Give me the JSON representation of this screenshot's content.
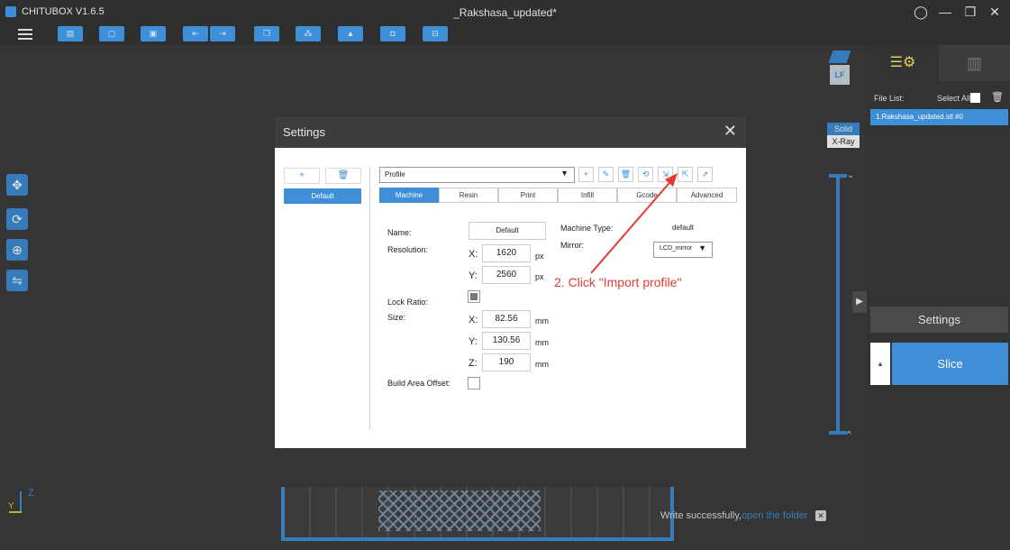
{
  "titlebar": {
    "app_name": "CHITUBOX V1.6.5",
    "document_title": "_Rakshasa_updated*",
    "user_icon": "user-icon",
    "min_glyph": "—",
    "max_glyph": "❐",
    "close_glyph": "✕"
  },
  "toolbar": {
    "menu_icon": "hamburger-icon",
    "buttons": [
      {
        "name": "open-file-button",
        "glyph": "▤"
      },
      {
        "name": "open-project-button",
        "glyph": "▢"
      },
      {
        "name": "save-button",
        "glyph": "▣"
      },
      {
        "name": "import-button",
        "glyph": "⇤"
      },
      {
        "name": "export-button",
        "glyph": "⇥"
      },
      {
        "name": "copy-button",
        "glyph": "❐"
      },
      {
        "name": "layout-button",
        "glyph": "⁂"
      },
      {
        "name": "support-button",
        "glyph": "▲"
      },
      {
        "name": "hollow-button",
        "glyph": "◘"
      },
      {
        "name": "cut-button",
        "glyph": "⊟"
      }
    ]
  },
  "viewport": {
    "side_tools": [
      {
        "name": "move-tool",
        "glyph": "✥"
      },
      {
        "name": "rotate-tool",
        "glyph": "⟳"
      },
      {
        "name": "scale-tool",
        "glyph": "⊕"
      },
      {
        "name": "mirror-tool",
        "glyph": "⇋"
      }
    ],
    "axis_z": "Z",
    "axis_y": "Y",
    "view_modes": {
      "solid": "Solid",
      "xray": "X-Ray"
    },
    "viewcube_label": "LF",
    "toast": {
      "message": "Write successfully,",
      "link": "open the folder",
      "close": "✕"
    },
    "layer_up": "⌄",
    "layer_down": "^",
    "collapse": "▶"
  },
  "right_panel": {
    "tab_edit_glyph": "☰⚙",
    "tab_support_glyph": "▥",
    "file_list_label": "File List:",
    "select_all_label": "Select All",
    "delete_glyph": "🗑",
    "files": [
      "1.Rakshasa_updated.stl #0"
    ],
    "settings_label": "Settings",
    "slice_label": "Slice",
    "slice_expand": "▲"
  },
  "dialog": {
    "title": "Settings",
    "close_glyph": "✕",
    "left": {
      "add_glyph": "+",
      "delete_glyph": "🗑",
      "profiles": [
        "Default"
      ]
    },
    "profile_select": "Profile",
    "profile_icons": [
      {
        "name": "new-profile-icon",
        "glyph": "+"
      },
      {
        "name": "edit-profile-icon",
        "glyph": "✎"
      },
      {
        "name": "delete-profile-icon",
        "glyph": "🗑"
      },
      {
        "name": "reset-profile-icon",
        "glyph": "⟲"
      },
      {
        "name": "import-profile-icon",
        "glyph": "⇲"
      },
      {
        "name": "export-profile-icon",
        "glyph": "⇱"
      },
      {
        "name": "share-profile-icon",
        "glyph": "⇗"
      }
    ],
    "tabs": [
      "Machine",
      "Resin",
      "Print",
      "Infill",
      "Gcode",
      "Advanced"
    ],
    "active_tab": "Machine",
    "machine": {
      "name_label": "Name:",
      "name_value": "Default",
      "machine_type_label": "Machine Type:",
      "machine_type_value": "default",
      "resolution_label": "Resolution:",
      "res_x_label": "X:",
      "res_x": "1620",
      "res_y_label": "Y:",
      "res_y": "2560",
      "res_unit": "px",
      "mirror_label": "Mirror:",
      "mirror_value": "LCD_mirror",
      "lock_ratio_label": "Lock Ratio:",
      "lock_ratio_checked": true,
      "size_label": "Size:",
      "size_x_label": "X:",
      "size_x": "82.56",
      "size_y_label": "Y:",
      "size_y": "130.56",
      "size_z_label": "Z:",
      "size_z": "190",
      "size_unit": "mm",
      "build_offset_label": "Build Area Offset:",
      "build_offset_checked": false
    }
  },
  "annotation": {
    "text": "2. Click \"Import profile\"",
    "color": "#e53935"
  },
  "colors": {
    "accent": "#3e8ed8",
    "background": "#3c3c3c",
    "panel": "#333333"
  }
}
